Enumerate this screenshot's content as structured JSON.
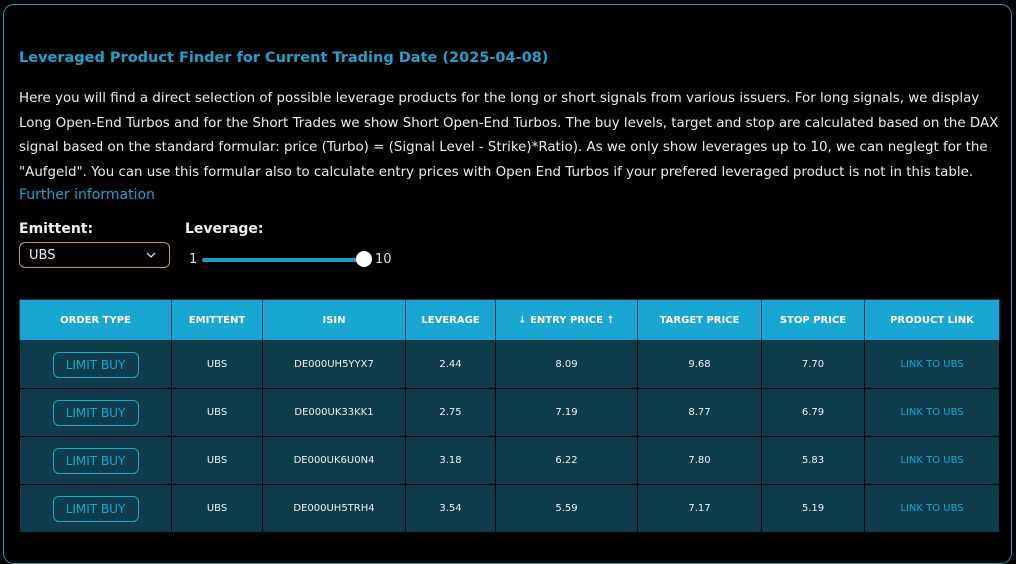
{
  "title": "Leveraged Product Finder for Current Trading Date (2025-04-08)",
  "description": "Here you will find a direct selection of possible leverage products for the long or short signals from various issuers. For long signals, we display Long Open-End Turbos and for the Short Trades we show Short Open-End Turbos. The buy levels, target and stop are calculated based on the DAX signal based on the standard formular: price (Turbo) = (Signal Level - Strike)*Ratio). As we only show leverages up to 10, we can neglegt for the \"Aufgeld\". You can use this formular also to calculate entry prices with Open End Turbos if your prefered leveraged product is not in this table.",
  "further_info": "Further information",
  "filters": {
    "emittent_label": "Emittent:",
    "emittent_value": "UBS",
    "leverage_label": "Leverage:",
    "leverage_min": "1",
    "leverage_max": "10",
    "leverage_selected": 10
  },
  "table": {
    "headers": [
      "ORDER TYPE",
      "EMITTENT",
      "ISIN",
      "LEVERAGE",
      "↓ ENTRY PRICE ↑",
      "TARGET PRICE",
      "STOP PRICE",
      "PRODUCT LINK"
    ],
    "rows": [
      {
        "order_type": "LIMIT BUY",
        "emittent": "UBS",
        "isin": "DE000UH5YYX7",
        "leverage": "2.44",
        "entry": "8.09",
        "target": "9.68",
        "stop": "7.70",
        "link": "LINK TO UBS"
      },
      {
        "order_type": "LIMIT BUY",
        "emittent": "UBS",
        "isin": "DE000UK33KK1",
        "leverage": "2.75",
        "entry": "7.19",
        "target": "8.77",
        "stop": "6.79",
        "link": "LINK TO UBS"
      },
      {
        "order_type": "LIMIT BUY",
        "emittent": "UBS",
        "isin": "DE000UK6U0N4",
        "leverage": "3.18",
        "entry": "6.22",
        "target": "7.80",
        "stop": "5.83",
        "link": "LINK TO UBS"
      },
      {
        "order_type": "LIMIT BUY",
        "emittent": "UBS",
        "isin": "DE000UH5TRH4",
        "leverage": "3.54",
        "entry": "5.59",
        "target": "7.17",
        "stop": "5.19",
        "link": "LINK TO UBS"
      }
    ]
  },
  "colors": {
    "accent": "#1aa6d3",
    "row_bg": "#0d3c4b",
    "select_border": "#c99a3a"
  }
}
